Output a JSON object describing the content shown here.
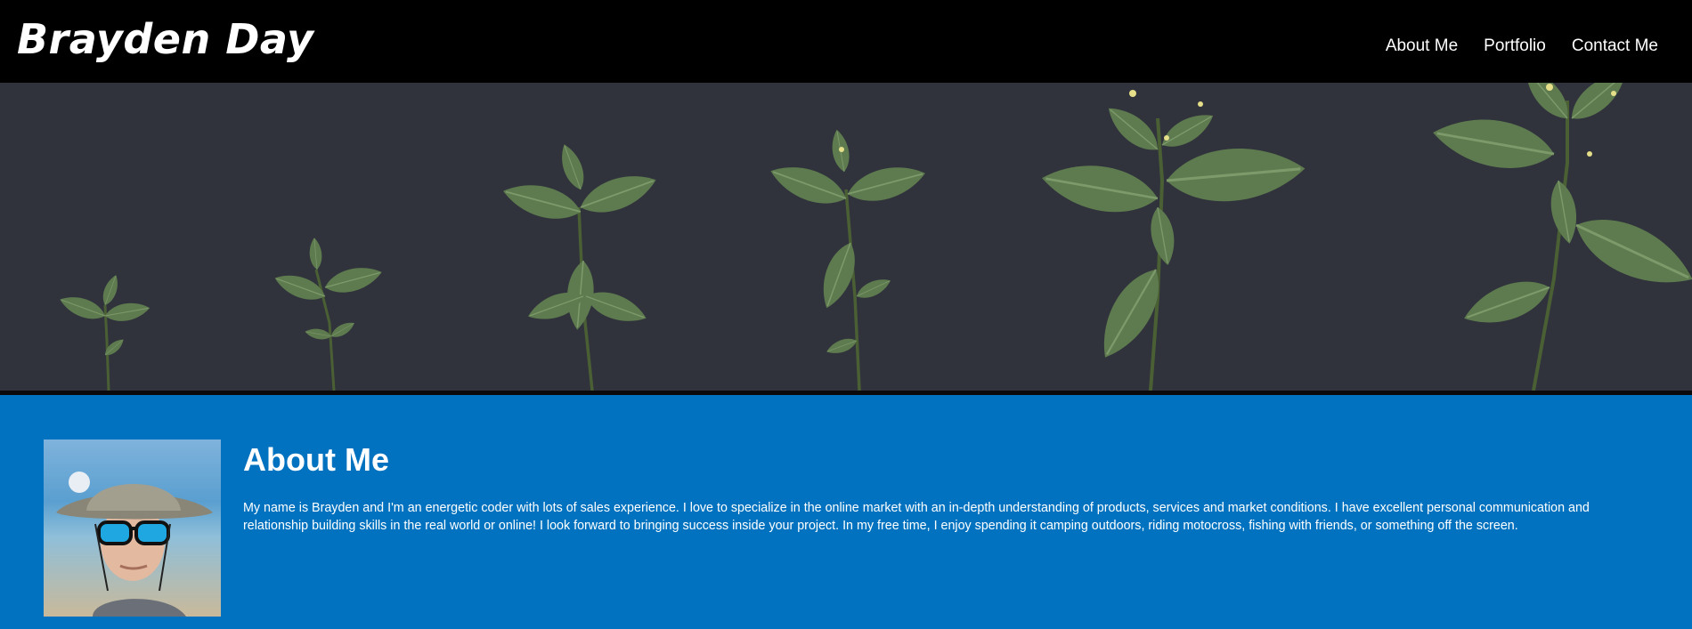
{
  "header": {
    "brand": "Brayden Day",
    "nav": [
      {
        "label": "About Me"
      },
      {
        "label": "Portfolio"
      },
      {
        "label": "Contact Me"
      }
    ]
  },
  "about": {
    "title": "About Me",
    "body": "My name is Brayden and I'm an energetic coder with lots of sales experience. I love to specialize in the online market with an in-depth understanding of products, services and market conditions. I have excellent personal communication and relationship building skills in the real world or online! I look forward to bringing success inside your project. In my free time, I enjoy spending it camping outdoors, riding motocross, fishing with friends, or something off the screen."
  },
  "colors": {
    "header_bg": "#000000",
    "hero_bg": "#30333b",
    "about_bg": "#0072bf",
    "text": "#ffffff"
  },
  "icons": {
    "hero": "plant-growth-stages-image",
    "avatar": "profile-photo"
  }
}
